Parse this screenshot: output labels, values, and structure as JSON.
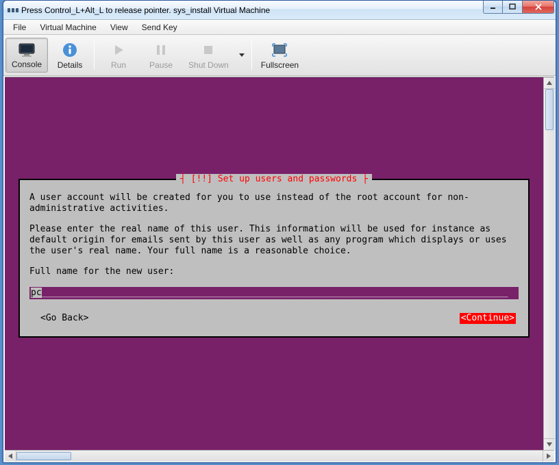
{
  "window": {
    "title": "Press Control_L+Alt_L to release pointer. sys_install Virtual Machine"
  },
  "menu": {
    "items": [
      "File",
      "Virtual Machine",
      "View",
      "Send Key"
    ]
  },
  "toolbar": {
    "console": "Console",
    "details": "Details",
    "run": "Run",
    "pause": "Pause",
    "shutdown": "Shut Down",
    "fullscreen": "Fullscreen"
  },
  "installer": {
    "title_prefix": "[!!] ",
    "title": "Set up users and passwords",
    "para1": "A user account will be created for you to use instead of the root account for non-administrative activities.",
    "para2": "Please enter the real name of this user. This information will be used for instance as default origin for emails sent by this user as well as any program which displays or uses the user's real name. Your full name is a reasonable choice.",
    "prompt": "Full name for the new user:",
    "input_value": "pc",
    "go_back": "<Go Back>",
    "continue": "<Continue>"
  }
}
